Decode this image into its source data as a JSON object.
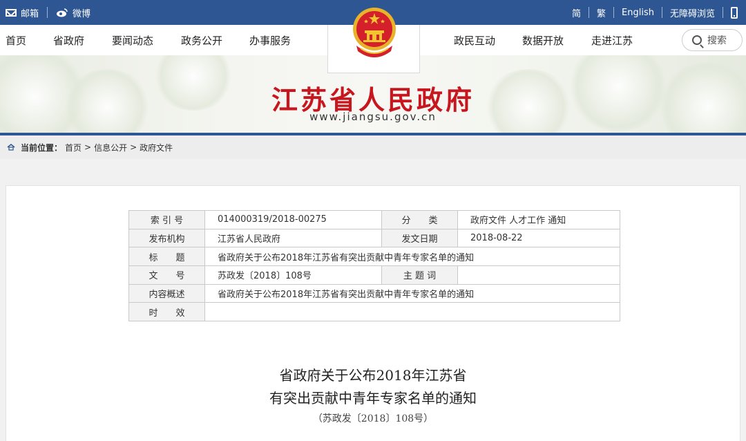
{
  "topbar": {
    "mail_label": "邮箱",
    "weibo_label": "微博",
    "simplified": "简",
    "traditional": "繁",
    "english": "English",
    "accessible": "无障碍浏览"
  },
  "nav": {
    "left": [
      "首页",
      "省政府",
      "要闻动态",
      "政务公开",
      "办事服务"
    ],
    "right": [
      "政民互动",
      "数据开放",
      "走进江苏"
    ],
    "search_label": "搜索"
  },
  "banner": {
    "title": "江苏省人民政府",
    "url": "www.jiangsu.gov.cn"
  },
  "breadcrumb": {
    "label": "当前位置：",
    "items": [
      "首页",
      "信息公开",
      "政府文件"
    ],
    "separator": ">"
  },
  "meta_table": {
    "index_label": "索 引 号",
    "index_value": "014000319/2018-00275",
    "category_label": "分　　类",
    "category_value": "政府文件 人才工作 通知",
    "publisher_label": "发布机构",
    "publisher_value": "江苏省人民政府",
    "date_label": "发文日期",
    "date_value": "2018-08-22",
    "title_label": "标　　题",
    "title_value": "省政府关于公布2018年江苏省有突出贡献中青年专家名单的通知",
    "docno_label": "文　　号",
    "docno_value": "苏政发〔2018〕108号",
    "keywords_label": "主 题 词",
    "keywords_value": "",
    "summary_label": "内容概述",
    "summary_value": "省政府关于公布2018年江苏省有突出贡献中青年专家名单的通知",
    "validity_label": "时　　效",
    "validity_value": ""
  },
  "document": {
    "title_line1": "省政府关于公布2018年江苏省",
    "title_line2": "有突出贡献中青年专家名单的通知",
    "number": "（苏政发〔2018〕108号）"
  },
  "colors": {
    "topbar_blue": "#2e5693",
    "title_red": "#c7161e"
  }
}
